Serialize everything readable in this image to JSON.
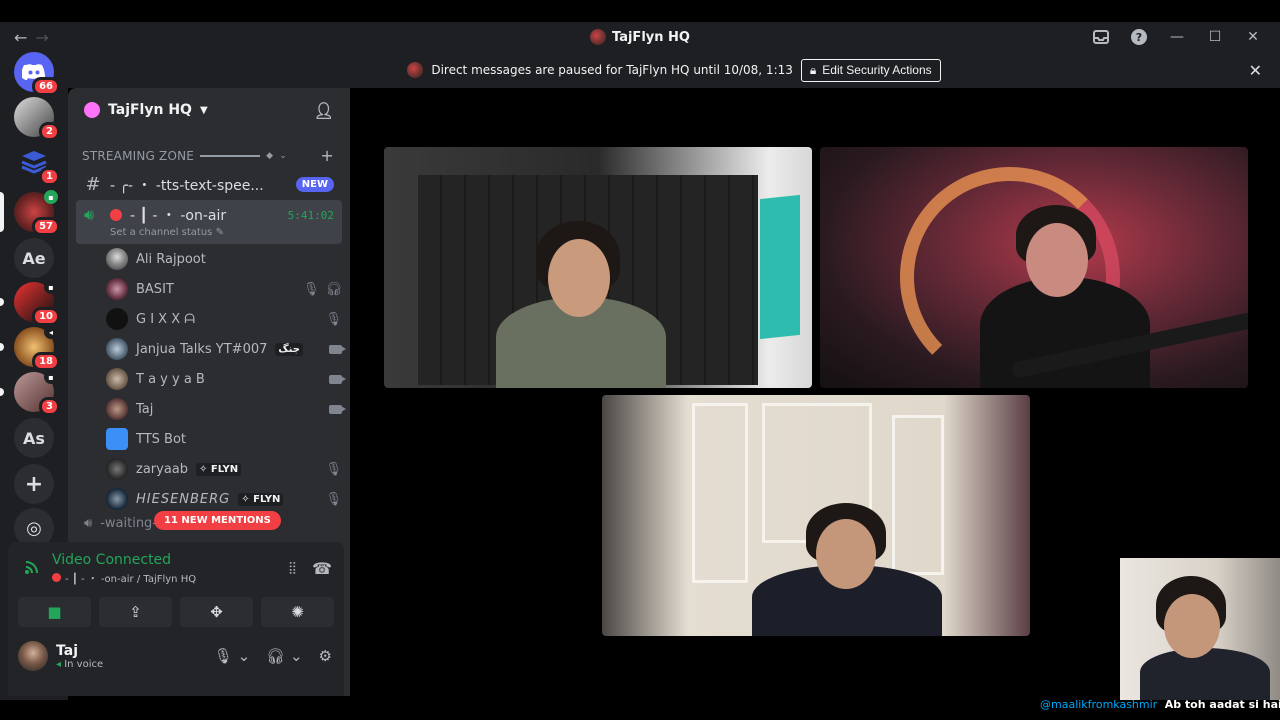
{
  "window": {
    "title": "TajFlyn HQ",
    "back": "←",
    "forward": "→",
    "inbox_icon": "inbox-icon",
    "help": "?",
    "minimize": "—",
    "maximize": "☐",
    "close": "✕"
  },
  "notice": {
    "text": "Direct messages are paused for TajFlyn HQ until 10/08, 1:13",
    "button": "Edit Security Actions",
    "close": "✕"
  },
  "servers": [
    {
      "label": "",
      "badge": "66"
    },
    {
      "label": "",
      "badge": "2"
    },
    {
      "label": "",
      "badge": "1"
    },
    {
      "label": "",
      "badge": "57"
    },
    {
      "label": "Ae",
      "badge": ""
    },
    {
      "label": "",
      "badge": "10"
    },
    {
      "label": "",
      "badge": "18"
    },
    {
      "label": "",
      "badge": "3"
    },
    {
      "label": "As",
      "badge": ""
    },
    {
      "label": "+",
      "badge": ""
    },
    {
      "label": "◎",
      "badge": ""
    }
  ],
  "sidebar": {
    "server_name": "TajFlyn HQ",
    "category": "STREAMING ZONE",
    "text_channel": "- ╭- ・ -tts-text-spee...",
    "new_badge": "NEW",
    "voice_channel": "- ┃ - ・ -on-air",
    "timer": "5:41:02",
    "channel_status": "Set a channel status",
    "members": [
      {
        "name": "Ali Rajpoot",
        "tag": "",
        "icons": ""
      },
      {
        "name": "BASIT",
        "tag": "",
        "icons": "mute-deafen"
      },
      {
        "name": "G I X X ᗩ",
        "tag": "",
        "icons": "mute"
      },
      {
        "name": "Janjua Talks YT#007",
        "tag": "جنگ",
        "icons": "camera"
      },
      {
        "name": "T a y y a B",
        "tag": "",
        "icons": "camera"
      },
      {
        "name": "Taj",
        "tag": "",
        "icons": "camera"
      },
      {
        "name": "TTS Bot",
        "tag": "",
        "icons": ""
      },
      {
        "name": "zaryaab",
        "tag": "FLYN",
        "icons": "mute"
      },
      {
        "name": "HIESENBERG",
        "tag": "FLYN",
        "icons": "mute"
      }
    ],
    "mentions": "11 NEW MENTIONS",
    "waiting_channel": "-waiting-lounge"
  },
  "voice_panel": {
    "status": "Video Connected",
    "location": "- ┃ - ・ -on-air / TajFlyn HQ",
    "buttons": [
      "camera-icon",
      "screen-share-icon",
      "activities-icon",
      "soundboard-icon"
    ]
  },
  "user": {
    "name": "Taj",
    "status": "In voice"
  },
  "caption": {
    "who": "@maalikfromkashmir",
    "message": "Ab toh aadat si hai mu"
  },
  "colors": {
    "accent": "#5865f2",
    "online": "#23a55a",
    "danger": "#f23f43"
  }
}
